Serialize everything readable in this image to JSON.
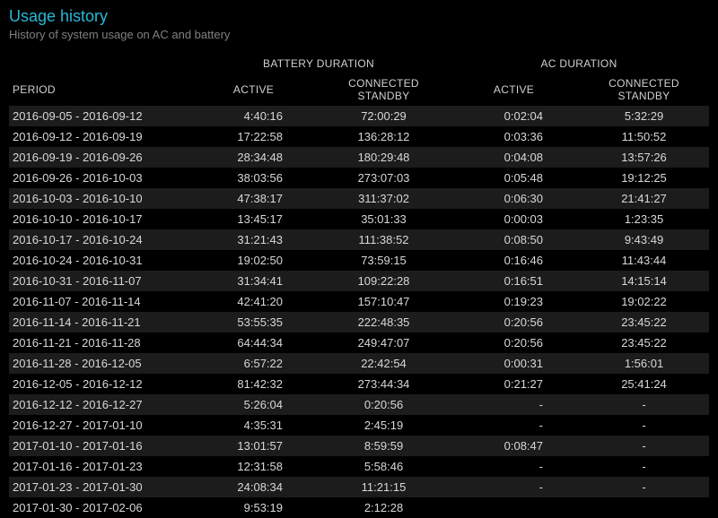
{
  "title": "Usage history",
  "subtitle": "History of system usage on AC and battery",
  "headers": {
    "group_battery": "BATTERY DURATION",
    "group_ac": "AC DURATION",
    "period": "PERIOD",
    "active": "ACTIVE",
    "connected_standby": "CONNECTED STANDBY"
  },
  "rows": [
    {
      "period": "2016-09-05 - 2016-09-12",
      "bat_active": "4:40:16",
      "bat_cs": "72:00:29",
      "ac_active": "0:02:04",
      "ac_cs": "5:32:29"
    },
    {
      "period": "2016-09-12 - 2016-09-19",
      "bat_active": "17:22:58",
      "bat_cs": "136:28:12",
      "ac_active": "0:03:36",
      "ac_cs": "11:50:52"
    },
    {
      "period": "2016-09-19 - 2016-09-26",
      "bat_active": "28:34:48",
      "bat_cs": "180:29:48",
      "ac_active": "0:04:08",
      "ac_cs": "13:57:26"
    },
    {
      "period": "2016-09-26 - 2016-10-03",
      "bat_active": "38:03:56",
      "bat_cs": "273:07:03",
      "ac_active": "0:05:48",
      "ac_cs": "19:12:25"
    },
    {
      "period": "2016-10-03 - 2016-10-10",
      "bat_active": "47:38:17",
      "bat_cs": "311:37:02",
      "ac_active": "0:06:30",
      "ac_cs": "21:41:27"
    },
    {
      "period": "2016-10-10 - 2016-10-17",
      "bat_active": "13:45:17",
      "bat_cs": "35:01:33",
      "ac_active": "0:00:03",
      "ac_cs": "1:23:35"
    },
    {
      "period": "2016-10-17 - 2016-10-24",
      "bat_active": "31:21:43",
      "bat_cs": "111:38:52",
      "ac_active": "0:08:50",
      "ac_cs": "9:43:49"
    },
    {
      "period": "2016-10-24 - 2016-10-31",
      "bat_active": "19:02:50",
      "bat_cs": "73:59:15",
      "ac_active": "0:16:46",
      "ac_cs": "11:43:44"
    },
    {
      "period": "2016-10-31 - 2016-11-07",
      "bat_active": "31:34:41",
      "bat_cs": "109:22:28",
      "ac_active": "0:16:51",
      "ac_cs": "14:15:14"
    },
    {
      "period": "2016-11-07 - 2016-11-14",
      "bat_active": "42:41:20",
      "bat_cs": "157:10:47",
      "ac_active": "0:19:23",
      "ac_cs": "19:02:22"
    },
    {
      "period": "2016-11-14 - 2016-11-21",
      "bat_active": "53:55:35",
      "bat_cs": "222:48:35",
      "ac_active": "0:20:56",
      "ac_cs": "23:45:22"
    },
    {
      "period": "2016-11-21 - 2016-11-28",
      "bat_active": "64:44:34",
      "bat_cs": "249:47:07",
      "ac_active": "0:20:56",
      "ac_cs": "23:45:22"
    },
    {
      "period": "2016-11-28 - 2016-12-05",
      "bat_active": "6:57:22",
      "bat_cs": "22:42:54",
      "ac_active": "0:00:31",
      "ac_cs": "1:56:01"
    },
    {
      "period": "2016-12-05 - 2016-12-12",
      "bat_active": "81:42:32",
      "bat_cs": "273:44:34",
      "ac_active": "0:21:27",
      "ac_cs": "25:41:24"
    },
    {
      "period": "2016-12-12 - 2016-12-27",
      "bat_active": "5:26:04",
      "bat_cs": "0:20:56",
      "ac_active": "-",
      "ac_cs": "-"
    },
    {
      "period": "2016-12-27 - 2017-01-10",
      "bat_active": "4:35:31",
      "bat_cs": "2:45:19",
      "ac_active": "-",
      "ac_cs": "-"
    },
    {
      "period": "2017-01-10 - 2017-01-16",
      "bat_active": "13:01:57",
      "bat_cs": "8:59:59",
      "ac_active": "0:08:47",
      "ac_cs": "-"
    },
    {
      "period": "2017-01-16 - 2017-01-23",
      "bat_active": "12:31:58",
      "bat_cs": "5:58:46",
      "ac_active": "-",
      "ac_cs": "-"
    },
    {
      "period": "2017-01-23 - 2017-01-30",
      "bat_active": "24:08:34",
      "bat_cs": "11:21:15",
      "ac_active": "-",
      "ac_cs": "-"
    },
    {
      "period": "2017-01-30 - 2017-02-06",
      "bat_active": "9:53:19",
      "bat_cs": "2:12:28",
      "ac_active": "",
      "ac_cs": ""
    }
  ]
}
